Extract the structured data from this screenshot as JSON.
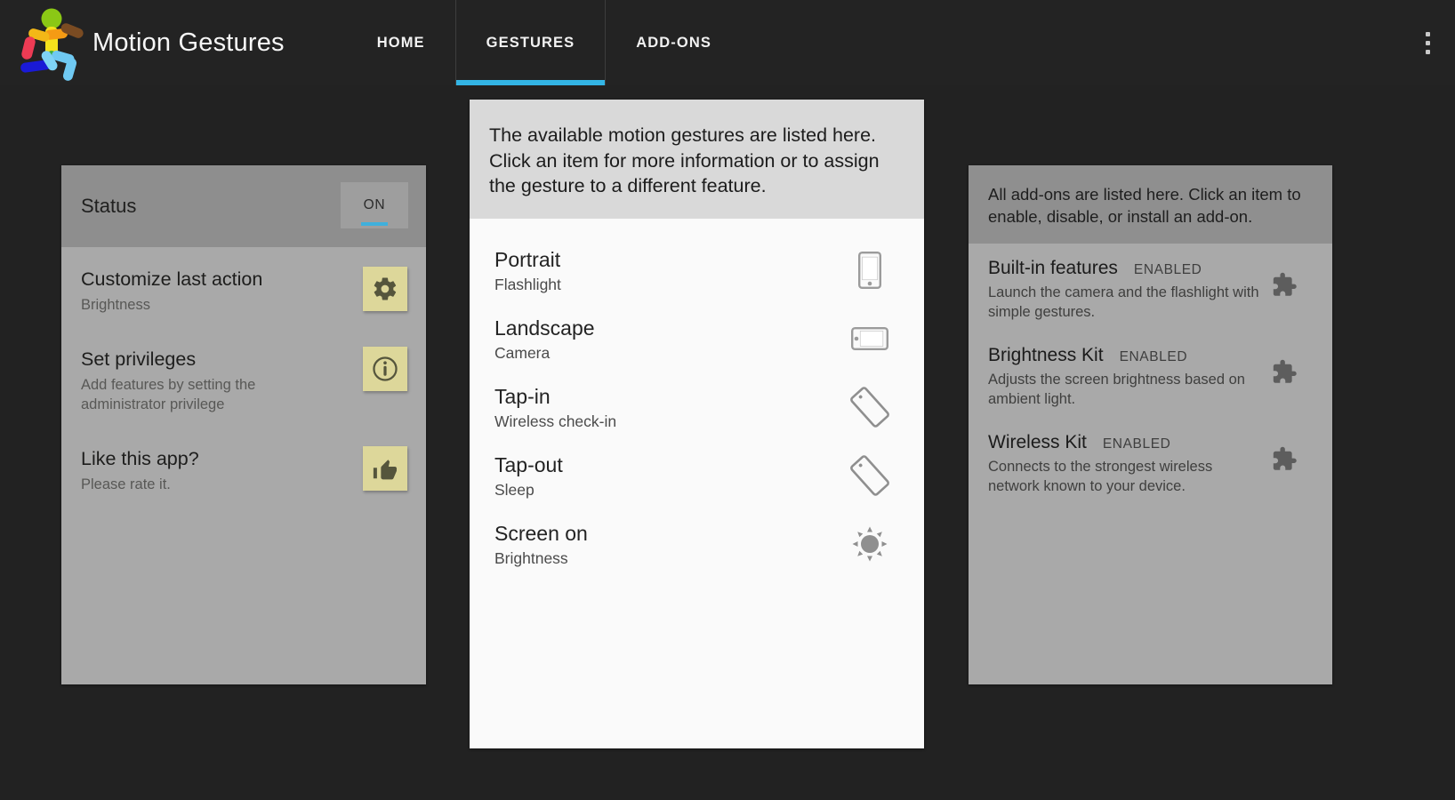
{
  "colors": {
    "appbar_bg": "#232323",
    "page_bg": "#222222",
    "accent": "#33b5e5",
    "card_bg": "#a9a9a9",
    "card_mid_bg": "#fafafa",
    "banner_mid_bg": "#d9d9d9",
    "banner_right_bg": "#8f8f8f",
    "note_icon_bg": "#ddd79a",
    "status_header_bg": "#8e8e8e"
  },
  "header": {
    "logo_icon": "running-figure-logo",
    "title": "Motion Gestures",
    "overflow_icon": "more-vert-icon",
    "tabs": [
      {
        "label": "HOME",
        "selected": false
      },
      {
        "label": "GESTURES",
        "selected": true
      },
      {
        "label": "ADD-ONS",
        "selected": false
      }
    ]
  },
  "status_card": {
    "status_label": "Status",
    "toggle_value": "ON",
    "rows": [
      {
        "title": "Customize last action",
        "subtitle": "Brightness",
        "icon": "gear-icon"
      },
      {
        "title": "Set privileges",
        "subtitle": "Add features by setting the administrator privilege",
        "icon": "info-icon"
      },
      {
        "title": "Like this app?",
        "subtitle": "Please rate it.",
        "icon": "thumbs-up-icon"
      }
    ]
  },
  "gestures_card": {
    "banner": "The available motion gestures are listed here. Click an item for more information or to assign the gesture to a different feature.",
    "items": [
      {
        "gesture": "Portrait",
        "action": "Flashlight",
        "icon": "phone-portrait-icon"
      },
      {
        "gesture": "Landscape",
        "action": "Camera",
        "icon": "phone-landscape-icon"
      },
      {
        "gesture": "Tap-in",
        "action": "Wireless check-in",
        "icon": "phone-tilt-icon"
      },
      {
        "gesture": "Tap-out",
        "action": "Sleep",
        "icon": "phone-tilt-icon"
      },
      {
        "gesture": "Screen on",
        "action": "Brightness",
        "icon": "brightness-icon"
      }
    ]
  },
  "addons_card": {
    "banner": "All add-ons are listed here. Click an item to enable, disable, or install an add-on.",
    "items": [
      {
        "title": "Built-in features",
        "state": "ENABLED",
        "description": "Launch the camera and the flashlight with simple gestures.",
        "icon": "puzzle-piece-icon"
      },
      {
        "title": "Brightness Kit",
        "state": "ENABLED",
        "description": "Adjusts the screen brightness based on ambient light.",
        "icon": "puzzle-piece-icon"
      },
      {
        "title": "Wireless Kit",
        "state": "ENABLED",
        "description": "Connects to the strongest wireless network known to your device.",
        "icon": "puzzle-piece-icon"
      }
    ]
  }
}
